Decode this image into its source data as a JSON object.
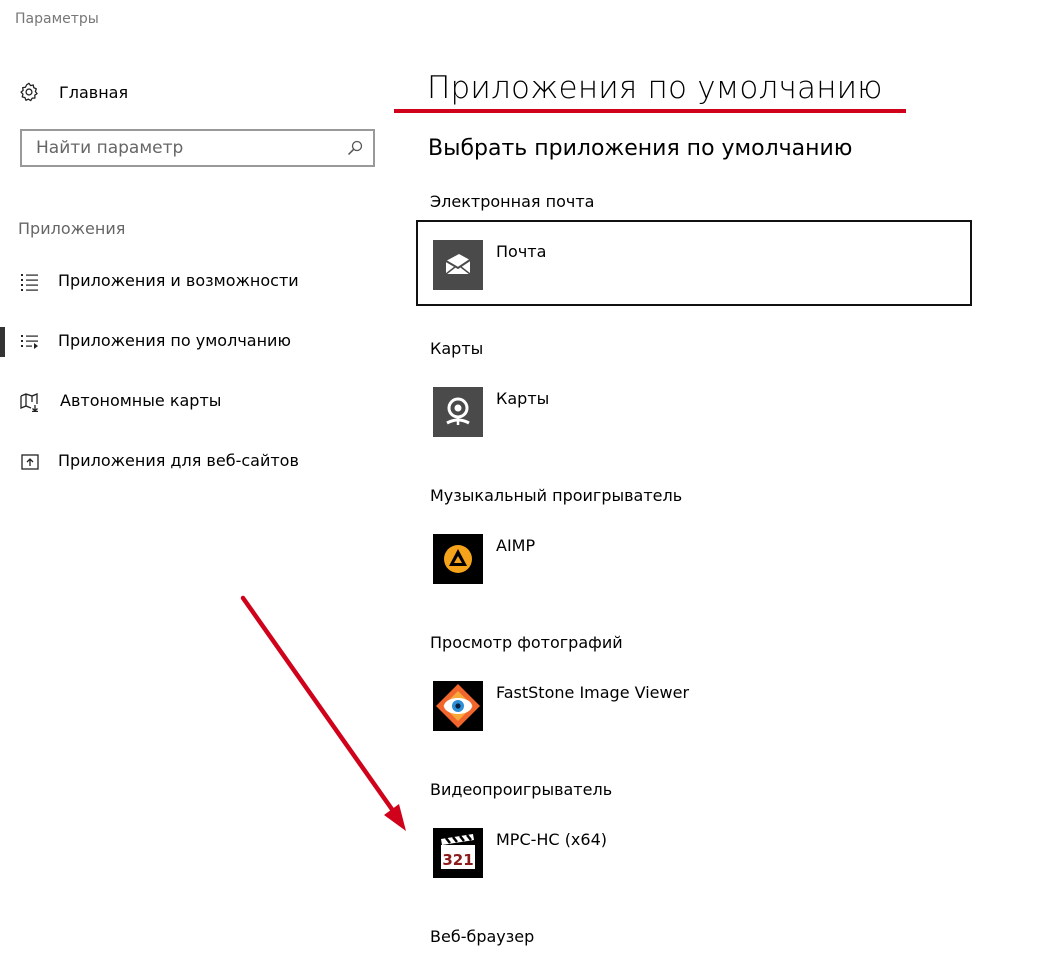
{
  "window": {
    "title": "Параметры"
  },
  "sidebar": {
    "home_label": "Главная",
    "search_placeholder": "Найти параметр",
    "section_label": "Приложения",
    "items": [
      {
        "label": "Приложения и возможности",
        "icon": "list-icon",
        "selected": false
      },
      {
        "label": "Приложения по умолчанию",
        "icon": "default-apps-icon",
        "selected": true
      },
      {
        "label": "Автономные карты",
        "icon": "offline-map-icon",
        "selected": false
      },
      {
        "label": "Приложения для веб-сайтов",
        "icon": "web-app-icon",
        "selected": false
      }
    ]
  },
  "main": {
    "title": "Приложения по умолчанию",
    "subtitle": "Выбрать приложения по умолчанию",
    "categories": [
      {
        "label": "Электронная почта",
        "app": "Почта",
        "icon": "mail-icon"
      },
      {
        "label": "Карты",
        "app": "Карты",
        "icon": "maps-icon"
      },
      {
        "label": "Музыкальный проигрыватель",
        "app": "AIMP",
        "icon": "aimp-icon"
      },
      {
        "label": "Просмотр фотографий",
        "app": "FastStone Image Viewer",
        "icon": "faststone-icon"
      },
      {
        "label": "Видеопроигрыватель",
        "app": "MPC-HC (x64)",
        "icon": "mpc-hc-icon"
      },
      {
        "label": "Веб-браузер"
      }
    ],
    "mpc_tile_text": "321"
  },
  "colors": {
    "annotation_red": "#d0021b",
    "tile_gray": "#4a4a4a",
    "accent_orange": "#f5a31a"
  }
}
